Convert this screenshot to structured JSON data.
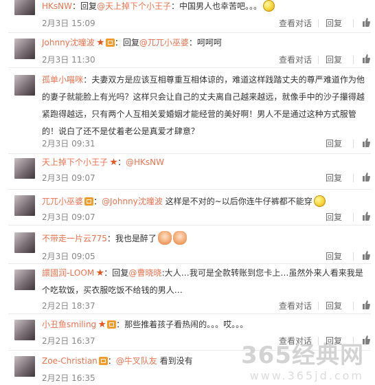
{
  "comments": [
    {
      "user": "HKsNW",
      "text": "：回复",
      "mention": "@天上掉下个小王子",
      "after": "：中国男人也幸苦吧。。。",
      "emoji": "sad-face-emoji",
      "time": "2月3日 15:09",
      "show_talk": true
    },
    {
      "user": "Johnny沈曈波",
      "text": "：回复",
      "mention": "@兀兀小巫婆",
      "after": "：呵呵呵",
      "time": "2月3日 11:30",
      "show_talk": true
    },
    {
      "user": "孤单小喵咪",
      "text": "：夫妻双方是应该互相尊重互相体谅的，难道这样践踏丈夫的尊严难道作为他的妻子就能脸上有光吗？这样只会让自己的丈夫离自己越来越远，就像手中的沙子攥得越紧跑得越远，只有两个人互相关爱婚姻才能经营的美好啊！男人不是通过这种方式服管的！说白了还不是仗着老公是真爱才肆意？",
      "time": "2月3日 09:31",
      "show_talk": false
    },
    {
      "user": "天上掉下个小王子",
      "text": "：",
      "mention": "@HKsNW",
      "after": "",
      "time": "2月3日 09:07",
      "show_talk": false
    },
    {
      "user": "兀兀小巫婆",
      "text": "：",
      "mention": "@Johnny沈曈波",
      "after": " 这样是不对的~以后你连牛仔裤都不能穿",
      "time": "2月3日 09:07",
      "show_talk": false
    },
    {
      "user": "不带走一片云775",
      "text": "：我也是醉了",
      "time": "2月3日 09:05",
      "show_talk": false
    },
    {
      "user": "譞國润-LOOM",
      "text": "：回复",
      "mention": "@曹晓晓",
      "after": ":大人…我可是全款转账到您卡上…虽然外来人看来我是个吃软饭，买衣服吃饭不给钱的男人…",
      "time": "2月2日 18:37",
      "show_talk": true
    },
    {
      "user": "小丑鱼smiling",
      "text": "：那些推着孩子看热闹的。。。哎。。。",
      "time": "2月2日 16:37",
      "show_talk": true
    },
    {
      "user": "Zoe-Christian",
      "text": "：",
      "mention": "@牛叉队友",
      "after": " 看到没有",
      "time": "2月2日 16:35",
      "show_talk": false
    }
  ],
  "actions": {
    "talk": "查看对话",
    "reply": "回复"
  },
  "colors": {
    "username": "#eb7350",
    "time": "#888888",
    "action": "#666666"
  },
  "watermark": {
    "text": "365经典网",
    "url": "www.365jd.com"
  }
}
